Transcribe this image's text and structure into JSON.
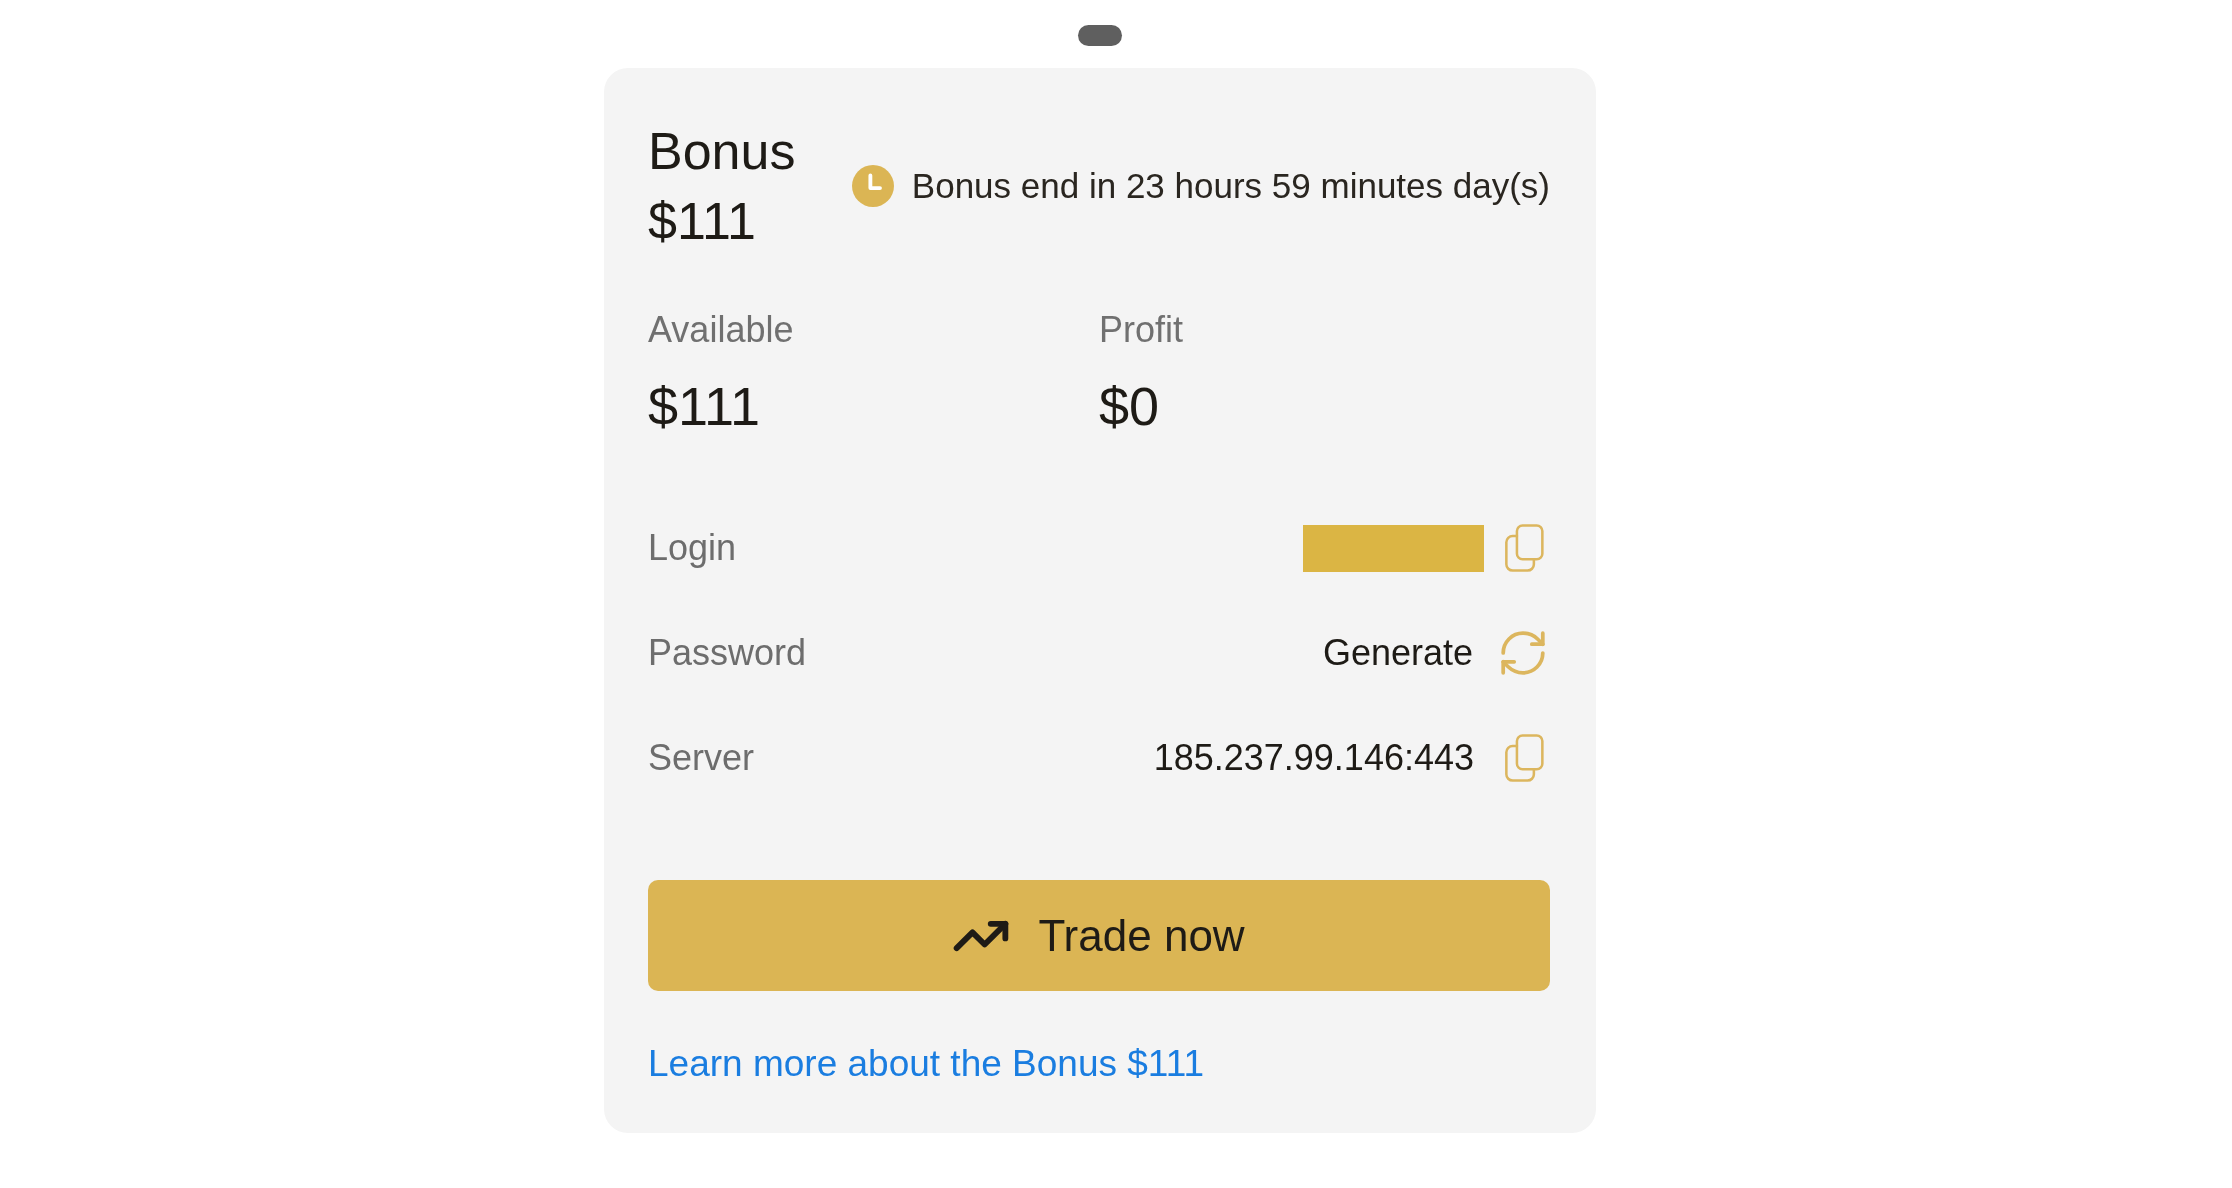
{
  "bonus": {
    "title": "Bonus $111",
    "timer": "Bonus end in 23 hours 59 minutes day(s)"
  },
  "stats": [
    {
      "label": "Available",
      "value": "$111"
    },
    {
      "label": "Profit",
      "value": "$0"
    }
  ],
  "credentials": [
    {
      "kind": "redacted",
      "label": "Login"
    },
    {
      "kind": "generate",
      "label": "Password",
      "value": "Generate"
    },
    {
      "kind": "copy",
      "label": "Server",
      "value": "185.237.99.146:443"
    }
  ],
  "trade_button": {
    "label": "Trade now"
  },
  "learn_more_link": "Learn more about the Bonus $111"
}
